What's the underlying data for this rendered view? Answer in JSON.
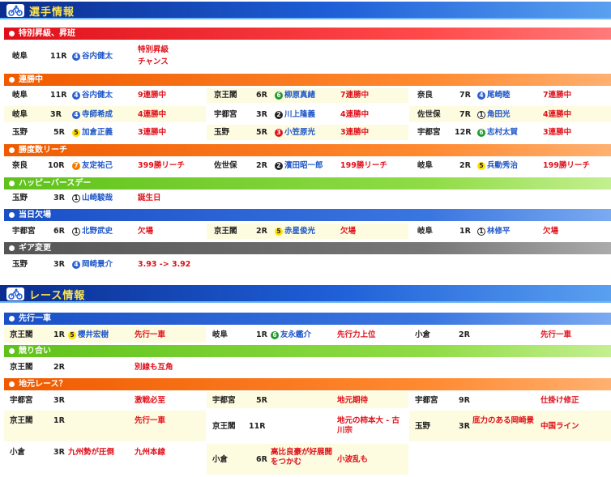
{
  "headers": {
    "player_info": "選手情報",
    "race_info": "レース情報"
  },
  "sections": {
    "promotion": "特別昇級、昇班",
    "streak": "連勝中",
    "milestone": "勝度数リーチ",
    "birthday": "ハッピーバースデー",
    "absent": "当日欠場",
    "gear": "ギア変更",
    "lead": "先行一車",
    "fight": "競り合い",
    "local": "地元レース？"
  },
  "promotion": [
    {
      "venue": "岐阜",
      "race": "11R",
      "num": "4",
      "name": "谷内健太",
      "note1": "特別昇級",
      "note2": "チャンス"
    }
  ],
  "streak": [
    {
      "venue": "岐阜",
      "race": "11R",
      "num": "4",
      "name": "谷内健太",
      "note": "9連勝中"
    },
    {
      "venue": "京王閣",
      "race": "6R",
      "num": "6",
      "name": "柳原真緒",
      "note": "7連勝中"
    },
    {
      "venue": "奈良",
      "race": "7R",
      "num": "4",
      "name": "尾崎睦",
      "note": "7連勝中"
    },
    {
      "venue": "岐阜",
      "race": "3R",
      "num": "4",
      "name": "寺師希成",
      "note": "4連勝中"
    },
    {
      "venue": "宇都宮",
      "race": "3R",
      "num": "2",
      "name": "川上隆義",
      "note": "4連勝中"
    },
    {
      "venue": "佐世保",
      "race": "7R",
      "num": "1",
      "name": "角田光",
      "note": "4連勝中"
    },
    {
      "venue": "玉野",
      "race": "5R",
      "num": "5",
      "name": "加倉正義",
      "note": "3連勝中"
    },
    {
      "venue": "玉野",
      "race": "5R",
      "num": "3",
      "name": "小笠原光",
      "note": "3連勝中"
    },
    {
      "venue": "宇都宮",
      "race": "12R",
      "num": "6",
      "name": "志村太賀",
      "note": "3連勝中"
    }
  ],
  "milestone": [
    {
      "venue": "奈良",
      "race": "10R",
      "num": "7",
      "name": "友定祐己",
      "note": "399勝リーチ"
    },
    {
      "venue": "佐世保",
      "race": "2R",
      "num": "2",
      "name": "濱田昭一郎",
      "note": "199勝リーチ"
    },
    {
      "venue": "岐阜",
      "race": "2R",
      "num": "5",
      "name": "兵動秀治",
      "note": "199勝リーチ"
    }
  ],
  "birthday": [
    {
      "venue": "玉野",
      "race": "3R",
      "num": "1",
      "name": "山崎駿哉",
      "note": "誕生日"
    }
  ],
  "absent": [
    {
      "venue": "宇都宮",
      "race": "6R",
      "num": "1",
      "name": "北野武史",
      "note": "欠場"
    },
    {
      "venue": "京王閣",
      "race": "2R",
      "num": "5",
      "name": "赤星俊光",
      "note": "欠場"
    },
    {
      "venue": "岐阜",
      "race": "1R",
      "num": "1",
      "name": "林修平",
      "note": "欠場"
    }
  ],
  "gear": [
    {
      "venue": "玉野",
      "race": "3R",
      "num": "4",
      "name": "岡崎景介",
      "note": "3.93 -> 3.92"
    }
  ],
  "lead": [
    {
      "venue": "京王閣",
      "race": "1R",
      "num": "5",
      "name": "櫻井宏樹",
      "note": "先行一車"
    },
    {
      "venue": "岐阜",
      "race": "1R",
      "num": "6",
      "name": "友永鑑介",
      "note": "先行力上位"
    },
    {
      "venue": "小倉",
      "race": "2R",
      "num": "",
      "name": "",
      "note": "先行一車"
    }
  ],
  "fight": [
    {
      "venue": "京王閣",
      "race": "2R",
      "note": "別線も互角"
    }
  ],
  "local": [
    {
      "venue": "宇都宮",
      "race": "3R",
      "note1": "",
      "note2": "激戦必至"
    },
    {
      "venue": "宇都宮",
      "race": "5R",
      "note1": "",
      "note2": "地元期待"
    },
    {
      "venue": "宇都宮",
      "race": "9R",
      "note1": "",
      "note2": "仕掛け修正"
    },
    {
      "venue": "京王閣",
      "race": "1R",
      "note1": "",
      "note2": "先行一車"
    },
    {
      "venue": "京王閣",
      "race": "11R",
      "note1": "",
      "note2": "地元の柿本大 - 古川宗"
    },
    {
      "venue": "玉野",
      "race": "3R",
      "note1": "底力のある岡崎景",
      "note2": "中国ライン"
    },
    {
      "venue": "小倉",
      "race": "3R",
      "note1": "九州勢が圧倒",
      "note2": "九州本線"
    },
    {
      "venue": "小倉",
      "race": "6R",
      "note1": "高比良豪が好展開をつかむ",
      "note2": "小波乱も"
    }
  ],
  "colors": {
    "red": "#e0101a",
    "orange": "#f05a00",
    "green": "#5fc21a",
    "blue": "#1a4fc6",
    "gray": "#666666",
    "name": "#1f57c9",
    "header": "#1f5fd8",
    "header_text": "#ffe54a"
  },
  "icons": {
    "player_header": "cyclist-icon",
    "race_header": "cyclist-icon"
  }
}
